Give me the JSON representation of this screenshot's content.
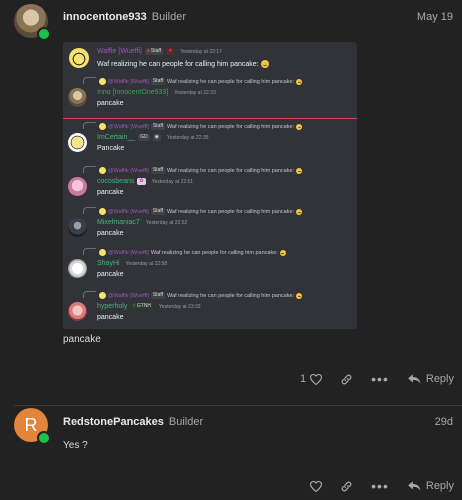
{
  "post1": {
    "username": "innocentone933",
    "title": "Builder",
    "date": "May 19",
    "body": "pancake",
    "likes": "1",
    "reply_label": "Reply"
  },
  "embed": {
    "original": {
      "name": "Waffle [Wueffi]",
      "tag": "Staff",
      "time": "Yesterday at 22:17",
      "text": "Waf realizing he can people for calling him pancake:"
    },
    "reply_prefix": "@Waffle [Wueffi]",
    "reply_tag": "Staff",
    "reply_text": "Waf realizing he can people for calling him pancake:",
    "messages": [
      {
        "name": "Inno [InnocentOne933]",
        "name_color": "#3ba55c",
        "tag": "",
        "time": "Yesterday at 22:33",
        "text": "pancake"
      },
      {
        "name": "ImCertain__",
        "name_color": "#43b581",
        "tag": "GD",
        "time": "Yesterday at 22:35",
        "text": "Pancake"
      },
      {
        "name": "cocosbeans",
        "name_color": "#43b581",
        "tag": "",
        "time": "Yesterday at 22:51",
        "text": "pancake"
      },
      {
        "name": "Mixelmaniac7",
        "name_color": "#43b581",
        "tag": "",
        "time": "Yesterday at 22:52",
        "text": "pancake"
      },
      {
        "name": "ShayHi",
        "name_color": "#43b581",
        "tag": "",
        "time": "Yesterday at 22:58",
        "text": "pancake"
      },
      {
        "name": "hyperholy",
        "name_color": "#43b581",
        "tag": "GTNH",
        "time": "Yesterday at 23:33",
        "text": "pancake"
      }
    ]
  },
  "post2": {
    "username": "RedstonePancakes",
    "title": "Builder",
    "date": "29d",
    "avatar_letter": "R",
    "body": "Yes ?",
    "reply_label": "Reply"
  },
  "colors": {
    "background": "#222222",
    "embed_bg": "#313338",
    "waffle_purple": "#9b59b6",
    "online_green": "#1bc24a",
    "avatar_orange": "#e2843a"
  }
}
